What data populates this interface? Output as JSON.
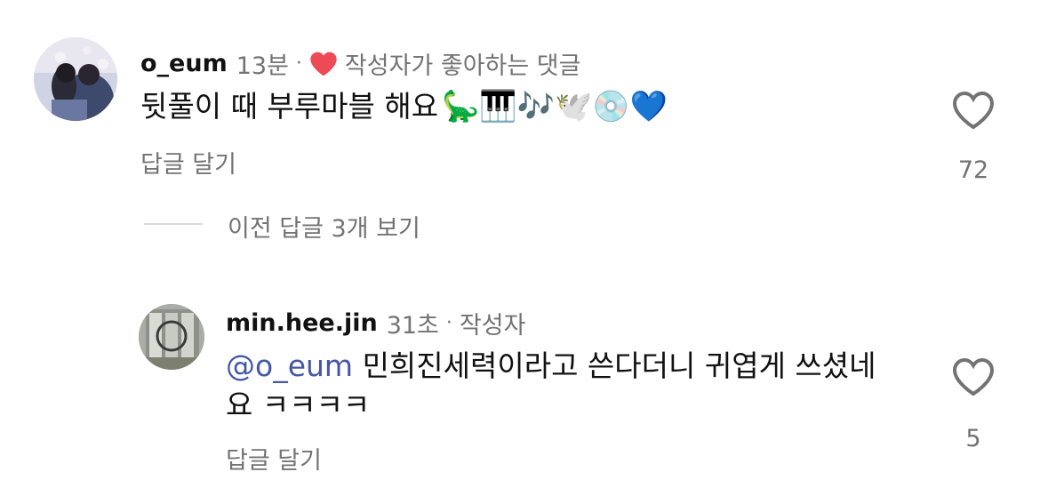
{
  "comments": [
    {
      "username": "o_eum",
      "time": "13분",
      "separator": "·",
      "liked_by_author_label": "작성자가 좋아하는 댓글",
      "text": "뒷풀이 때 부루마블 해요",
      "emojis": "🦕🎹🎶🕊️💿💙",
      "reply_label": "답글 달기",
      "like_count": "72"
    },
    {
      "username": "min.hee.jin",
      "time": "31초",
      "separator": "·",
      "author_label": "작성자",
      "mention": "@o_eum",
      "text_line1": "민희진세력이라고 쓴다더니 귀엽게 쓰셨네",
      "text_line2": "요 ㅋㅋㅋㅋ",
      "reply_label": "답글 달기",
      "like_count": "5"
    }
  ],
  "view_previous_replies": "이전 답글 3개 보기",
  "colors": {
    "heart_red": "#ed4956",
    "mention_blue": "#4457a8",
    "meta_gray": "#737373"
  }
}
